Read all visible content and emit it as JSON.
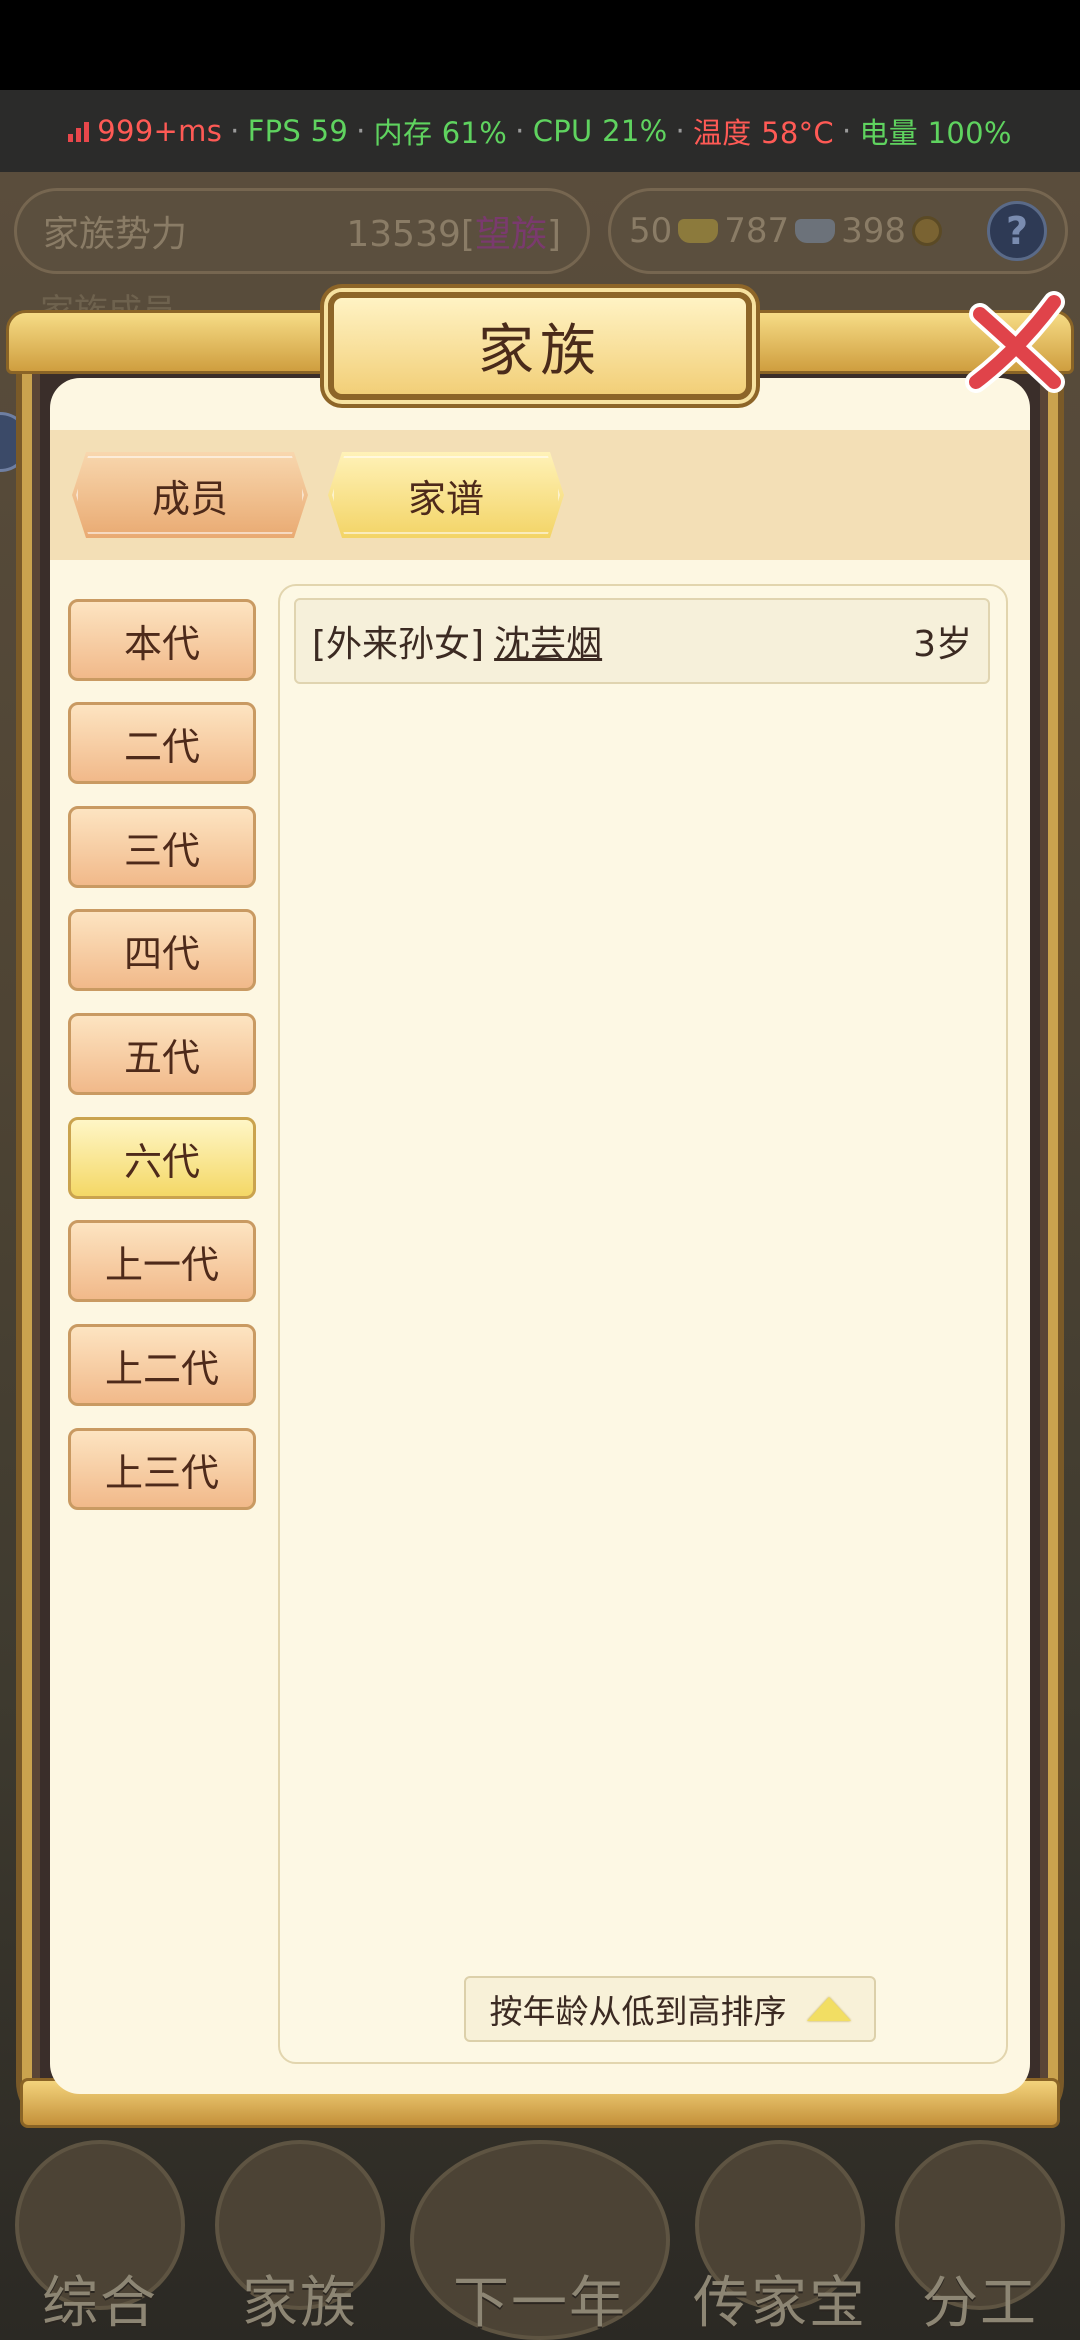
{
  "perf": {
    "latency": "999+ms",
    "fps": "FPS 59",
    "memory": "内存 61%",
    "cpu": "CPU 21%",
    "temp": "温度 58°C",
    "battery": "电量 100%",
    "separator": "·",
    "colors": {
      "red": "#ff5a55",
      "green": "#5fd35f"
    }
  },
  "hud": {
    "power_label": "家族势力",
    "power_value": "13539",
    "power_bracket_open": "[",
    "power_tag": "望族",
    "power_bracket_close": "]",
    "gold": "50",
    "silver": "787",
    "coins": "398",
    "help": "?",
    "row2_label": "家族成员"
  },
  "dialog": {
    "title": "家族",
    "tabs": [
      {
        "label": "成员",
        "active": false
      },
      {
        "label": "家谱",
        "active": true
      }
    ],
    "generations": [
      {
        "label": "本代",
        "active": false
      },
      {
        "label": "二代",
        "active": false
      },
      {
        "label": "三代",
        "active": false
      },
      {
        "label": "四代",
        "active": false
      },
      {
        "label": "五代",
        "active": false
      },
      {
        "label": "六代",
        "active": true
      },
      {
        "label": "上一代",
        "active": false
      },
      {
        "label": "上二代",
        "active": false
      },
      {
        "label": "上三代",
        "active": false
      }
    ],
    "entries": [
      {
        "relation": "[外来孙女]",
        "name": "沈芸烟",
        "age": "3岁"
      }
    ],
    "sort_label": "按年龄从低到高排序"
  },
  "nav": [
    {
      "label": "综合"
    },
    {
      "label": "家族"
    },
    {
      "label": "下一年"
    },
    {
      "label": "传家宝"
    },
    {
      "label": "分工"
    }
  ]
}
